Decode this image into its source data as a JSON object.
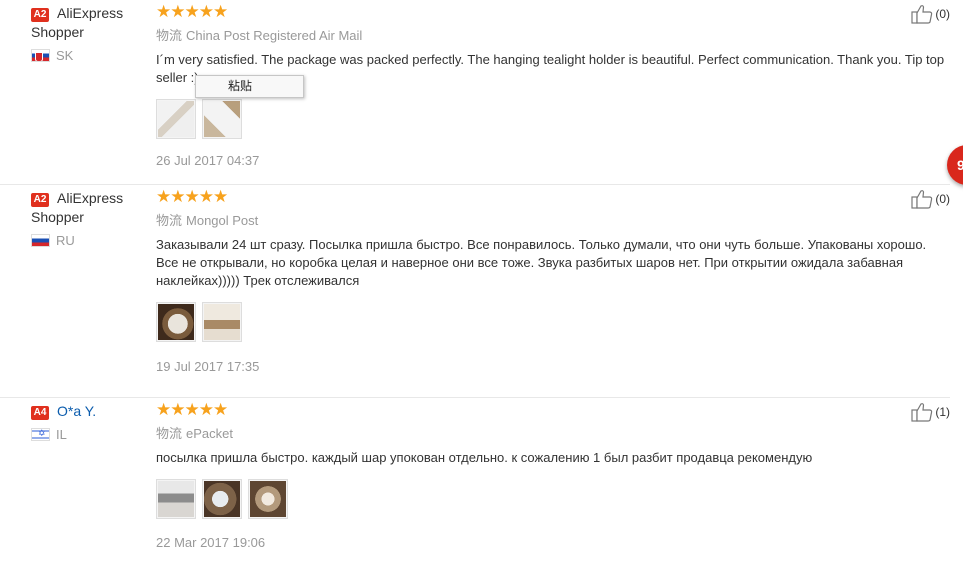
{
  "logistics_label": "物流",
  "paste_menu_label": "粘贴",
  "floating_badge_text": "9",
  "reviews": [
    {
      "level": "A2",
      "user_name": "AliExpress Shopper",
      "country": "SK",
      "rating": 5,
      "stars": "★★★★★",
      "logistics": "China Post Registered Air Mail",
      "text": "I´m very satisfied. The package was packed perfectly. The hanging tealight holder is beautiful. Perfect communication. Thank you. Tip top seller :)",
      "date": "26 Jul 2017 04:37",
      "helpful_count": "(0)"
    },
    {
      "level": "A2",
      "user_name": "AliExpress Shopper",
      "country": "RU",
      "rating": 5,
      "stars": "★★★★★",
      "logistics": "Mongol Post",
      "text": "Заказывали 24 шт сразу. Посылка пришла быстро. Все понравилось. Только думали, что они чуть больше. Упакованы хорошо. Все не открывали, но коробка целая и наверное они все тоже. Звука разбитых шаров нет. При открытии ожидала забавная наклейках))))) Трек отслеживался",
      "date": "19 Jul 2017 17:35",
      "helpful_count": "(0)"
    },
    {
      "level": "A4",
      "user_name": "O*a Y.",
      "country": "IL",
      "rating": 5,
      "stars": "★★★★★",
      "logistics": "ePacket",
      "text": "посылка пришла быстро. каждый шар упокован отдельно. к сожалению 1 был разбит продавца рекомендую",
      "date": "22 Mar 2017 19:06",
      "helpful_count": "(1)"
    }
  ],
  "colors": {
    "level_badge": "#e0301e",
    "stars": "#f7a21d",
    "link": "#0b5cad",
    "meta_text": "#999999"
  }
}
